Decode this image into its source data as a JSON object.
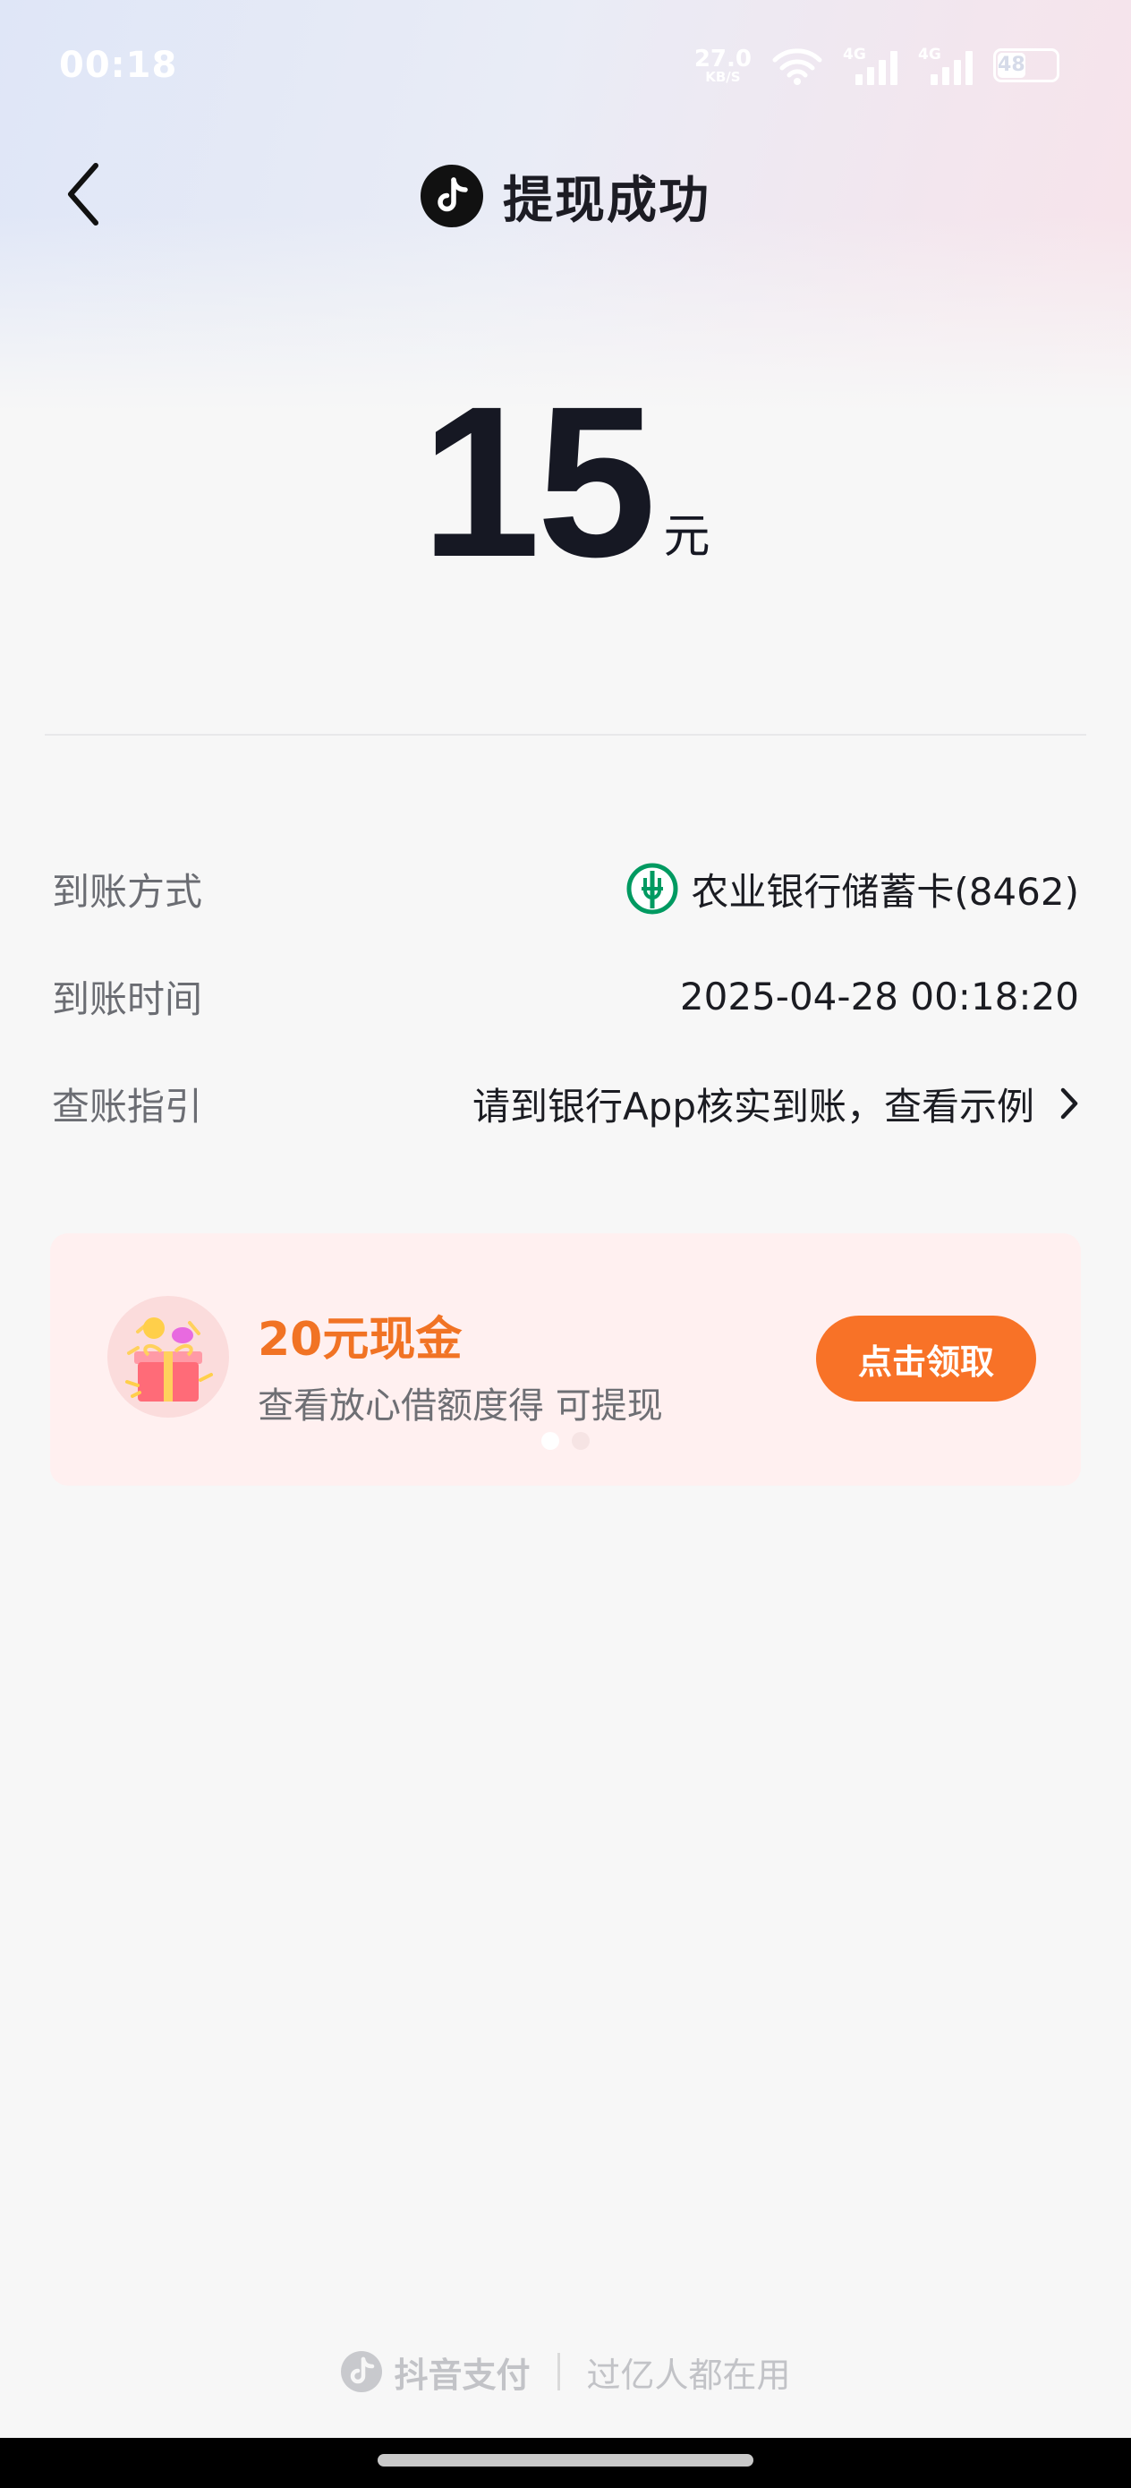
{
  "status_bar": {
    "time": "00:18",
    "net_speed_value": "27.0",
    "net_speed_unit": "KB/S",
    "sim1_label": "4G",
    "sim2_label": "4G",
    "battery": "48"
  },
  "header": {
    "title": "提现成功",
    "logo_icon": "douyin-logo-icon",
    "back_icon": "back-arrow-icon"
  },
  "amount": {
    "value": "15",
    "unit": "元"
  },
  "details": [
    {
      "label": "到账方式",
      "value": "农业银行储蓄卡(8462)",
      "icon": "abc-bank-icon"
    },
    {
      "label": "到账时间",
      "value": "2025-04-28 00:18:20"
    },
    {
      "label": "查账指引",
      "value": "请到银行App核实到账，查看示例",
      "icon": "chevron-right-icon"
    }
  ],
  "promo": {
    "title": "20元现金",
    "subtitle": "查看放心借额度得 可提现",
    "button_label": "点击领取",
    "icon": "gift-box-icon",
    "slides": 2,
    "active_slide": 1
  },
  "footer": {
    "brand": "抖音支付",
    "slogan": "过亿人都在用"
  },
  "colors": {
    "accent_orange": "#f87227",
    "promo_title": "#f17324",
    "bank_green": "#009a61"
  }
}
